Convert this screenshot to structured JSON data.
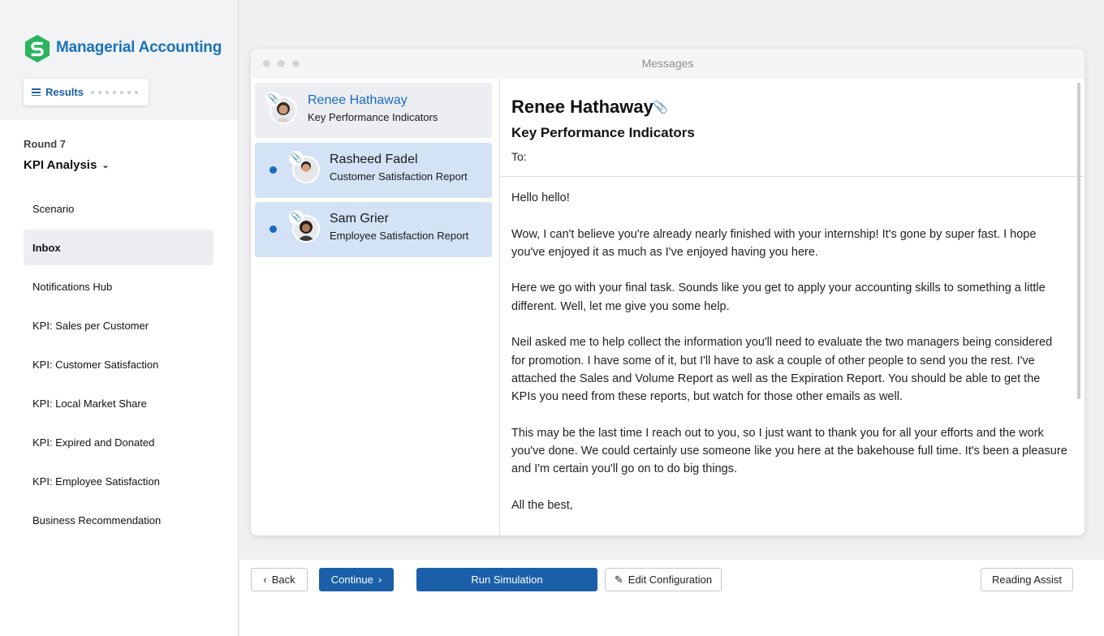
{
  "app": {
    "title": "Managerial Accounting",
    "results_label": "Results"
  },
  "sidebar": {
    "round": "Round 7",
    "section": "KPI Analysis",
    "items": [
      {
        "label": "Scenario",
        "active": false
      },
      {
        "label": "Inbox",
        "active": true
      },
      {
        "label": "Notifications Hub",
        "active": false
      },
      {
        "label": "KPI: Sales per Customer",
        "active": false
      },
      {
        "label": "KPI: Customer Satisfaction",
        "active": false
      },
      {
        "label": "KPI: Local Market Share",
        "active": false
      },
      {
        "label": "KPI: Expired and Donated",
        "active": false
      },
      {
        "label": "KPI: Employee Satisfaction",
        "active": false
      },
      {
        "label": "Business Recommendation",
        "active": false
      }
    ]
  },
  "window": {
    "title": "Messages"
  },
  "messages": [
    {
      "sender": "Renee Hathaway",
      "subject": "Key Performance Indicators",
      "unread": false,
      "attachment": true
    },
    {
      "sender": "Rasheed Fadel",
      "subject": "Customer Satisfaction Report",
      "unread": true,
      "attachment": true
    },
    {
      "sender": "Sam Grier",
      "subject": "Employee Satisfaction Report",
      "unread": true,
      "attachment": true
    }
  ],
  "reader": {
    "from": "Renee Hathaway",
    "subject": "Key Performance Indicators",
    "to_label": "To:",
    "paragraphs": [
      "Hello hello!",
      "Wow, I can't believe you're already nearly finished with your internship! It's gone by super fast. I hope you've enjoyed it as much as I've enjoyed having you here.",
      "Here we go with your final task. Sounds like you get to apply your accounting skills to something a little different. Well, let me give you some help.",
      "Neil asked me to help collect the information you'll need to evaluate the two managers being considered for promotion. I have some of it, but I'll have to ask a couple of other people to send you the rest. I've attached the Sales and Volume Report as well as the Expiration Report. You should be able to get the KPIs you need from these reports, but watch for those other emails as well.",
      "This may be the last time I reach out to you, so I just want to thank you for all your efforts and the work you've done. We could certainly use someone like you here at the bakehouse full time. It's been a pleasure and I'm certain you'll go on to do big things.",
      "All the best,"
    ]
  },
  "toolbar": {
    "back": "Back",
    "continue": "Continue",
    "run_simulation": "Run Simulation",
    "edit_configuration": "Edit Configuration",
    "reading_assist": "Reading Assist"
  },
  "colors": {
    "brand": "#1a73b8",
    "primary": "#1a5fa8",
    "logo": "#2bb35e",
    "unread_bg": "#d3e3f5"
  }
}
